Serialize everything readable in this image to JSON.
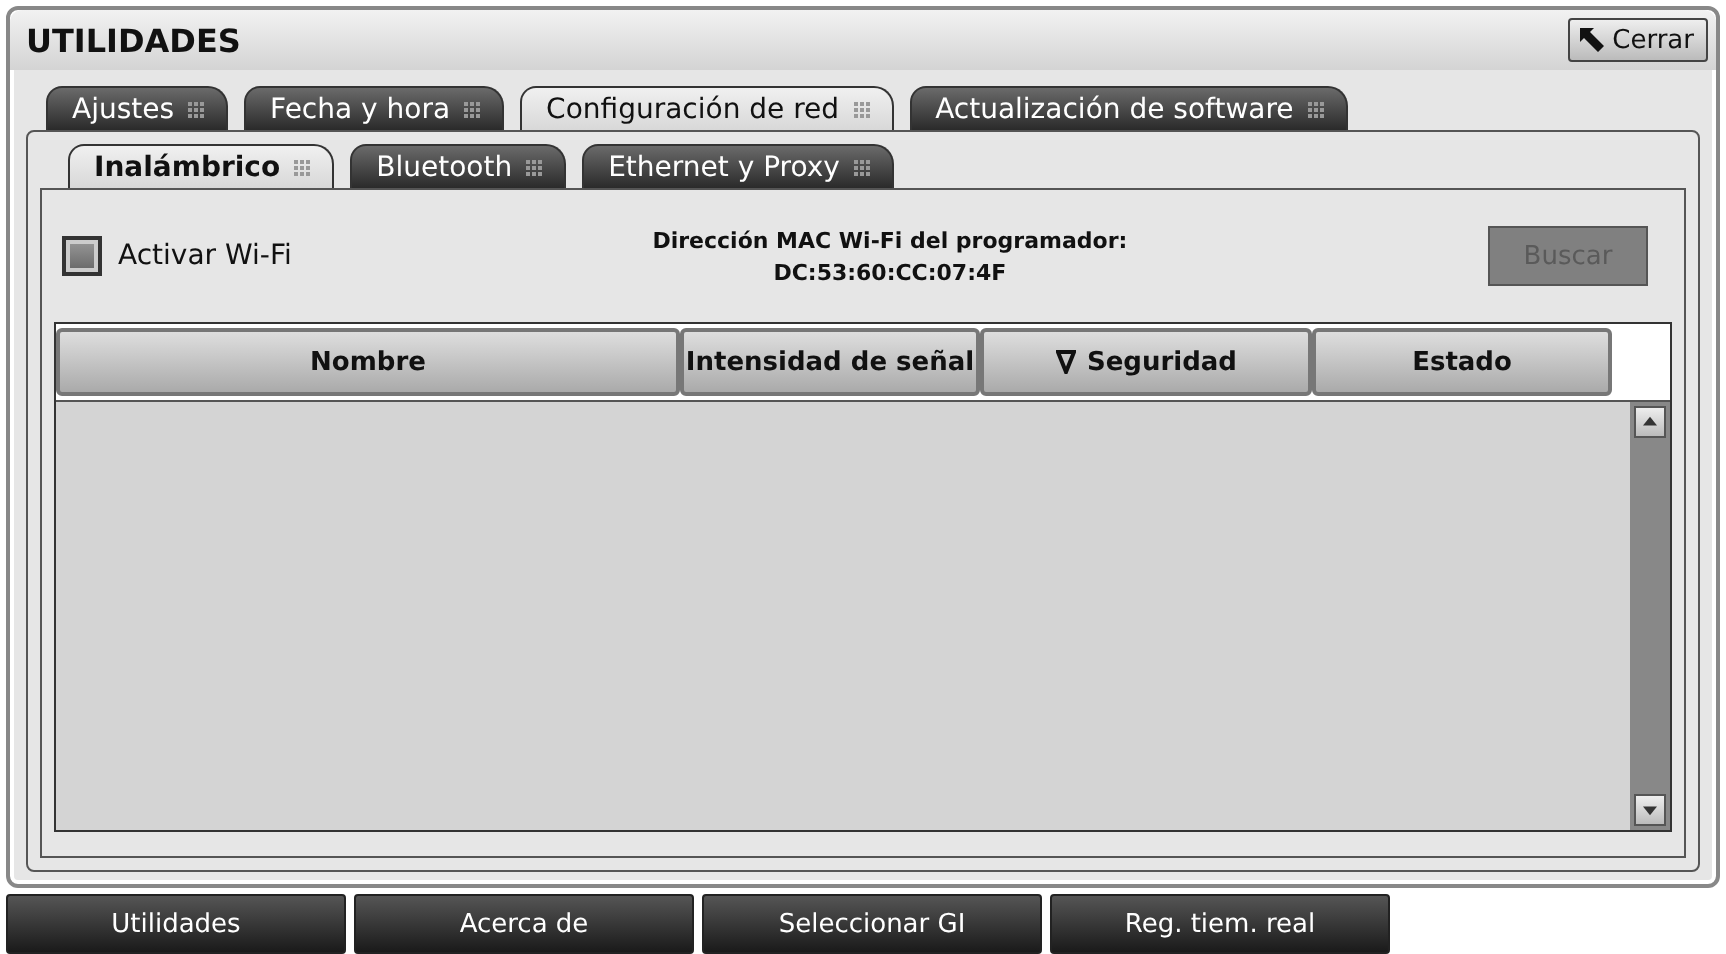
{
  "window": {
    "title": "UTILIDADES",
    "close_button": "Cerrar"
  },
  "tabs": [
    {
      "label": "Ajustes",
      "selected": false
    },
    {
      "label": "Fecha y hora",
      "selected": false
    },
    {
      "label": "Configuración de red",
      "selected": true
    },
    {
      "label": "Actualización de software",
      "selected": false
    }
  ],
  "subtabs": [
    {
      "label": "Inalámbrico",
      "selected": true
    },
    {
      "label": "Bluetooth",
      "selected": false
    },
    {
      "label": "Ethernet y Proxy",
      "selected": false
    }
  ],
  "wifi_toggle": {
    "label": "Activar Wi-Fi",
    "checked": false
  },
  "mac_address": {
    "label": "Dirección MAC Wi-Fi del programador:",
    "value": "DC:53:60:CC:07:4F"
  },
  "search_button": {
    "label": "Buscar",
    "disabled": true
  },
  "table": {
    "columns": [
      {
        "label": "Nombre",
        "sorted": false
      },
      {
        "label": "Intensidad de señal",
        "sorted": false
      },
      {
        "label": "Seguridad",
        "sorted": true
      },
      {
        "label": "Estado",
        "sorted": false
      }
    ]
  },
  "bottom_nav": [
    "Utilidades",
    "Acerca de",
    "Seleccionar GI",
    "Reg. tiem. real"
  ]
}
